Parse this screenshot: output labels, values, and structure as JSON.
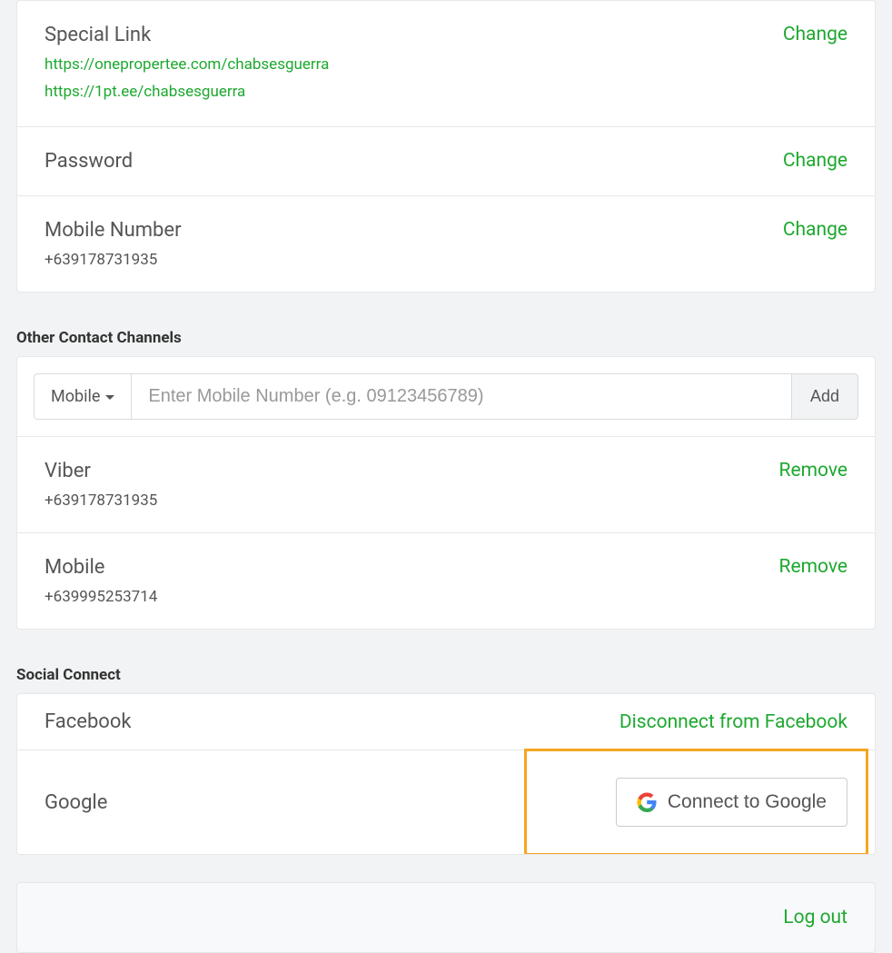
{
  "account": {
    "special_link": {
      "title": "Special Link",
      "link1": "https://onepropertee.com/chabsesguerra",
      "link2": "https://1pt.ee/chabsesguerra",
      "action": "Change"
    },
    "password": {
      "title": "Password",
      "action": "Change"
    },
    "mobile": {
      "title": "Mobile Number",
      "value": "+639178731935",
      "action": "Change"
    }
  },
  "other_contacts": {
    "section_title": "Other Contact Channels",
    "dropdown_label": "Mobile",
    "input_placeholder": "Enter Mobile Number (e.g. 09123456789)",
    "add_label": "Add",
    "items": [
      {
        "title": "Viber",
        "value": "+639178731935",
        "action": "Remove"
      },
      {
        "title": "Mobile",
        "value": "+639995253714",
        "action": "Remove"
      }
    ]
  },
  "social": {
    "section_title": "Social Connect",
    "facebook": {
      "title": "Facebook",
      "action": "Disconnect from Facebook"
    },
    "google": {
      "title": "Google",
      "button_label": "Connect to Google"
    }
  },
  "logout": {
    "label": "Log out"
  }
}
